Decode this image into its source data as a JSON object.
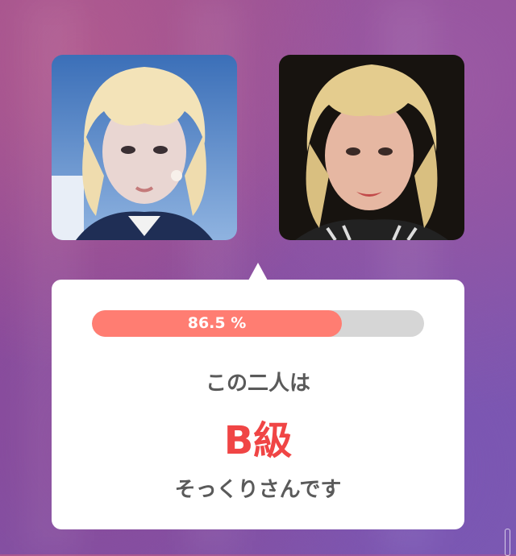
{
  "result": {
    "percentage": 86.5,
    "percentage_label": "86.5 %",
    "line1": "この二人は",
    "grade": "B級",
    "line3": "そっくりさんです"
  },
  "photos": {
    "left_name": "face-photo-left",
    "right_name": "face-photo-right"
  },
  "colors": {
    "progress_fill": "#ff7d72",
    "progress_track": "#d6d6d6",
    "grade": "#f04545",
    "text": "#5a5a5a"
  }
}
